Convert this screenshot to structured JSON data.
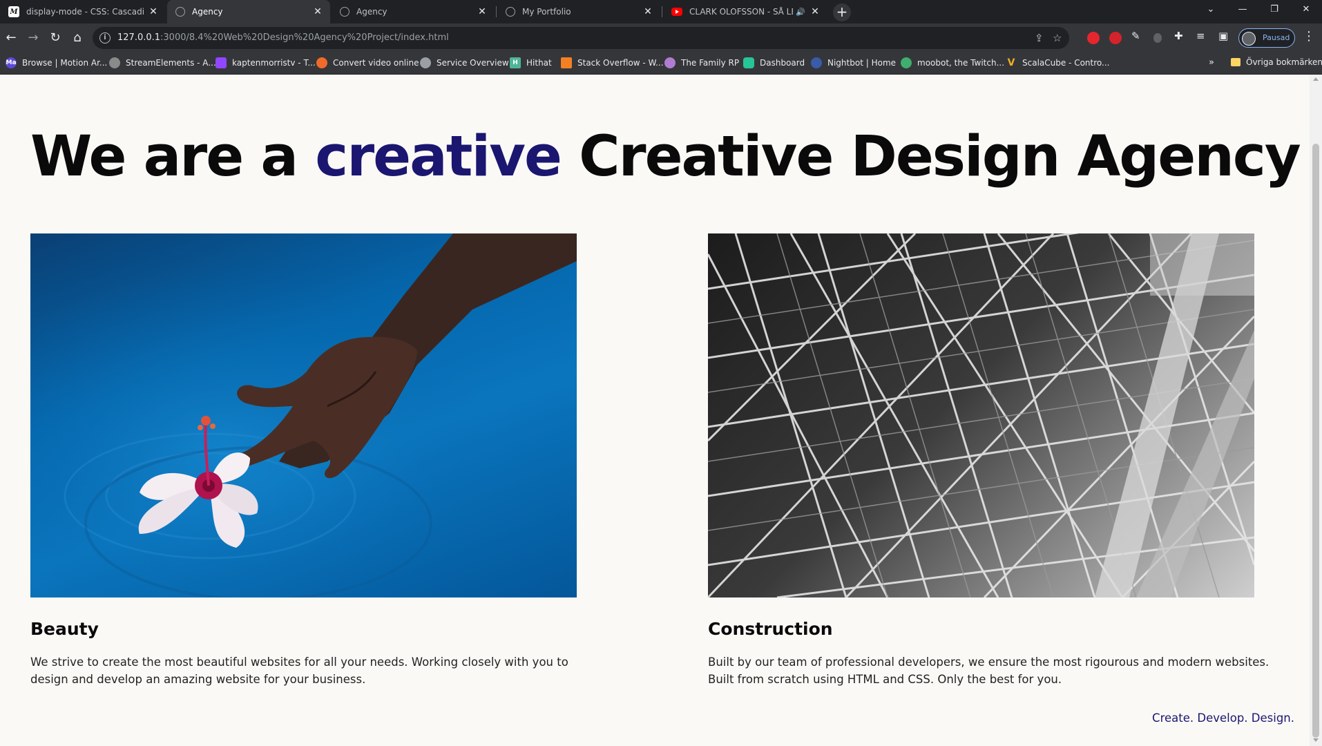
{
  "browser": {
    "tabs": [
      {
        "title": "display-mode - CSS: Cascading S",
        "favicon": "mdn-m-icon",
        "favicon_text": "M",
        "active": false
      },
      {
        "title": "Agency",
        "favicon": "globe-icon",
        "active": true
      },
      {
        "title": "Agency",
        "favicon": "globe-icon",
        "active": false
      },
      {
        "title": "My Portfolio",
        "favicon": "globe-icon",
        "active": false
      },
      {
        "title": "CLARK OLOFSSON - SÅ LEVE",
        "favicon": "youtube-icon",
        "active": false
      }
    ],
    "address": {
      "host": "127.0.0.1",
      "path": ":3000/8.4%20Web%20Design%20Agency%20Project/index.html"
    },
    "profile_label": "Pausad",
    "bookmarks": [
      {
        "label": "Browse | Motion Ar...",
        "color": "#5b4bd6",
        "icon_text": "Ma"
      },
      {
        "label": "StreamElements - A...",
        "color": "#8a8a8a",
        "icon_text": ""
      },
      {
        "label": "kaptenmorristv - T...",
        "color": "#9146ff",
        "icon_text": ""
      },
      {
        "label": "Convert video online",
        "color": "#f06a2a",
        "icon_text": ""
      },
      {
        "label": "Service Overview",
        "color": "#9aa0a6",
        "icon_text": ""
      },
      {
        "label": "Hithat",
        "color": "#4fb59a",
        "icon_text": "H"
      },
      {
        "label": "Stack Overflow - W...",
        "color": "#f48024",
        "icon_text": ""
      },
      {
        "label": "The Family RP",
        "color": "#b07ccf",
        "icon_text": ""
      },
      {
        "label": "Dashboard",
        "color": "#27c498",
        "icon_text": ""
      },
      {
        "label": "Nightbot | Home",
        "color": "#3a5ba8",
        "icon_text": ""
      },
      {
        "label": "moobot, the Twitch...",
        "color": "#3fae6e",
        "icon_text": ""
      },
      {
        "label": "ScalaCube - Contro...",
        "color": "#f0b020",
        "icon_text": "V"
      }
    ],
    "other_bookmarks": "Övriga bokmärken",
    "colors": {
      "tabstrip": "#202124",
      "toolbar": "#35363a",
      "omnibox": "#202124"
    }
  },
  "page": {
    "hero": {
      "before": "We are a ",
      "accent": "creative",
      "after": " Creative Design Agency"
    },
    "cards": [
      {
        "title": "Beauty",
        "text": "We strive to create the most beautiful websites for all your needs. Working closely with you to design and develop an amazing website for your business.",
        "image": "hand-with-flower-in-water"
      },
      {
        "title": "Construction",
        "text": "Built by our team of professional developers, we ensure the most rigourous and modern websites. Built from scratch using HTML and CSS. Only the best for you.",
        "image": "steel-lattice-structure"
      }
    ],
    "tagline": "Create. Develop. Design.",
    "colors": {
      "accent": "#1b1670",
      "background": "#faf9f6",
      "text": "#0a0a0a"
    }
  }
}
